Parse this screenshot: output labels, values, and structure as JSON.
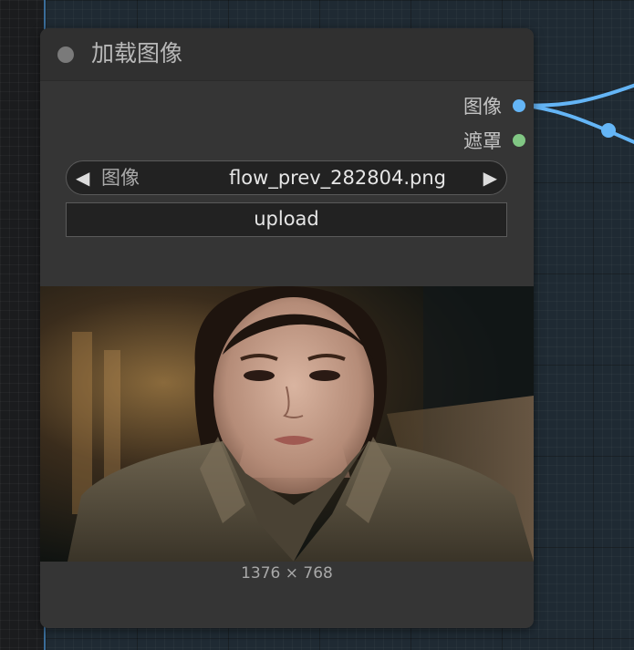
{
  "node": {
    "title": "加载图像",
    "outputs": [
      {
        "label": "图像",
        "color": "#64b5f6"
      },
      {
        "label": "遮罩",
        "color": "#81c784"
      }
    ],
    "image_widget": {
      "label": "图像",
      "value": "flow_prev_282804.png"
    },
    "upload_label": "upload",
    "preview_dimensions": "1376 × 768"
  },
  "colors": {
    "node_bg": "#353535",
    "canvas_bg": "#1f2a33",
    "link": "#64b5f6"
  },
  "icons": {
    "prev": "triangle-left-icon",
    "next": "triangle-right-icon",
    "status": "status-dot-icon"
  }
}
